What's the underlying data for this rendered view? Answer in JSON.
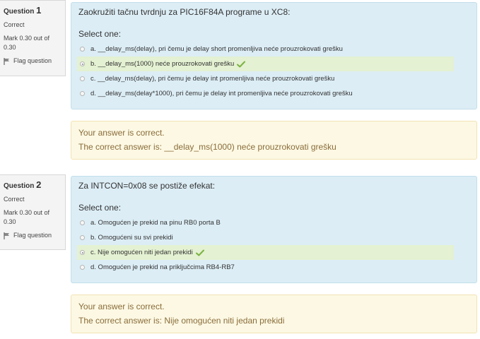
{
  "questions": [
    {
      "label": "Question",
      "number": "1",
      "state": "Correct",
      "mark": "Mark 0.30 out of 0.30",
      "flag": "Flag question",
      "text": "Zaokružiti tačnu tvrdnju za PIC16F84A programe u XC8:",
      "prompt": "Select one:",
      "answers": [
        {
          "label": "a. __delay_ms(delay), pri čemu je delay short promenljiva neće prouzrokovati grešku"
        },
        {
          "label": "b. __delay_ms(1000) neće prouzrokovati grešku"
        },
        {
          "label": "c. __delay_ms(delay), pri čemu je delay int promenljiva neće prouzrokovati grešku"
        },
        {
          "label": "d. __delay_ms(delay*1000), pri čemu je delay int promenljiva neće prouzrokovati grešku"
        }
      ],
      "feedback": "Your answer is correct.",
      "right_answer": "The correct answer is: __delay_ms(1000) neće prouzrokovati grešku"
    },
    {
      "label": "Question",
      "number": "2",
      "state": "Correct",
      "mark": "Mark 0.30 out of 0.30",
      "flag": "Flag question",
      "text": "Za INTCON=0x08 se postiže efekat:",
      "prompt": "Select one:",
      "answers": [
        {
          "label": "a. Omogućen je prekid na pinu RB0 porta B"
        },
        {
          "label": "b. Omogućeni su svi prekidi"
        },
        {
          "label": "c. Nije omogućen niti jedan prekidi"
        },
        {
          "label": "d. Omogućen je prekid na priključcima RB4-RB7"
        }
      ],
      "feedback": "Your answer is correct.",
      "right_answer": "The correct answer is: Nije omogućen niti jedan prekidi"
    }
  ],
  "colors": {
    "formulation_bg": "#dcedf5",
    "correct_row_bg": "#e4f1d2",
    "outcome_bg": "#fcf8e3",
    "checkmark": "#7cb342"
  }
}
